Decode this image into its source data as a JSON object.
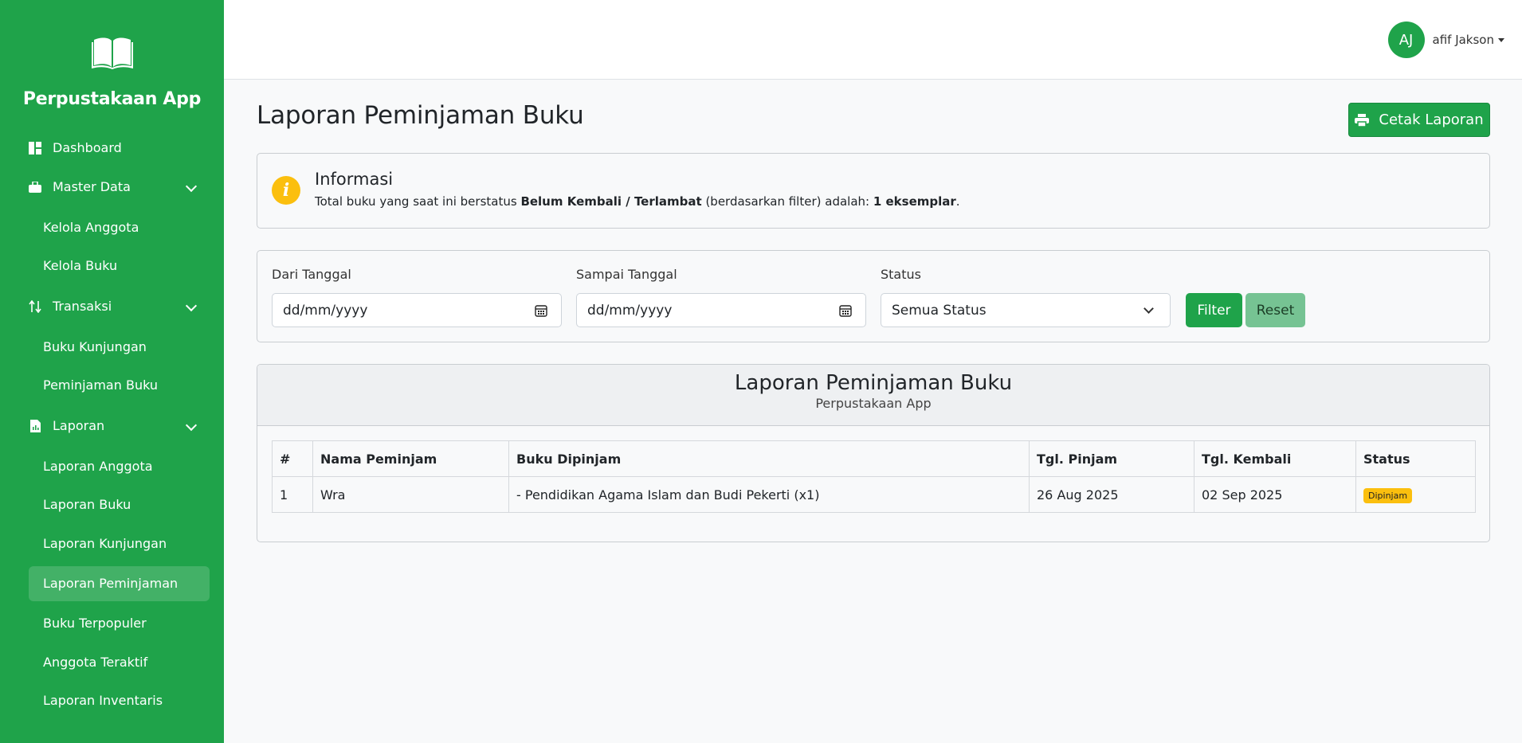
{
  "sidebar": {
    "brand": "Perpustakaan App",
    "items": [
      {
        "label": "Dashboard",
        "icon": "dashboard-icon"
      },
      {
        "label": "Master Data",
        "icon": "briefcase-icon",
        "children": [
          "Kelola Anggota",
          "Kelola Buku"
        ]
      },
      {
        "label": "Transaksi",
        "icon": "swap-arrows-icon",
        "children": [
          "Buku Kunjungan",
          "Peminjaman Buku"
        ]
      },
      {
        "label": "Laporan",
        "icon": "report-icon",
        "children": [
          "Laporan Anggota",
          "Laporan Buku",
          "Laporan Kunjungan",
          "Laporan Peminjaman",
          "Buku Terpopuler",
          "Anggota Teraktif",
          "Laporan Inventaris"
        ]
      }
    ],
    "active": "Laporan Peminjaman"
  },
  "topbar": {
    "avatar_initials": "AJ",
    "username": "afif Jakson"
  },
  "page": {
    "title": "Laporan Peminjaman Buku",
    "print_button": "Cetak Laporan"
  },
  "info": {
    "title": "Informasi",
    "text_before": "Total buku yang saat ini berstatus ",
    "text_bold1": "Belum Kembali / Terlambat",
    "text_mid": " (berdasarkan filter) adalah: ",
    "text_bold2": "1 eksemplar",
    "text_after": "."
  },
  "filter": {
    "from_label": "Dari Tanggal",
    "from_value": "dd/mm/yyyy",
    "to_label": "Sampai Tanggal",
    "to_value": "dd/mm/yyyy",
    "status_label": "Status",
    "status_value": "Semua Status",
    "filter_button": "Filter",
    "reset_button": "Reset"
  },
  "report": {
    "title": "Laporan Peminjaman Buku",
    "subtitle": "Perpustakaan App",
    "columns": [
      "#",
      "Nama Peminjam",
      "Buku Dipinjam",
      "Tgl. Pinjam",
      "Tgl. Kembali",
      "Status"
    ],
    "rows": [
      {
        "no": "1",
        "name": "Wra",
        "books": "- Pendidikan Agama Islam dan Budi Pekerti (x1)",
        "borrow_date": "26 Aug 2025",
        "return_date": "02 Sep 2025",
        "status": "Dipinjam"
      }
    ]
  },
  "colors": {
    "primary": "#1fa34a",
    "warning": "#fbbf0e"
  }
}
